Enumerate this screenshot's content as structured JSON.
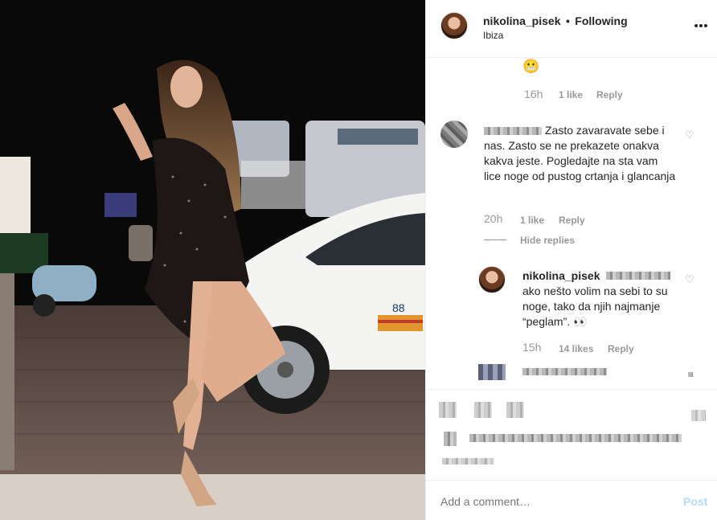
{
  "post": {
    "username": "nikolina_pisek",
    "separator": "•",
    "follow_status": "Following",
    "location": "Ibiza",
    "more_icon": "more-horizontal-icon"
  },
  "comments": [
    {
      "emoji": "😬",
      "time": "16h",
      "likes": "1 like",
      "reply": "Reply"
    },
    {
      "text": "Zasto zavaravate sebe i nas. Zasto se ne prekazete onakva kakva jeste. Pogledajte na sta vam lice noge od pustog crtanja i glancanja",
      "time": "20h",
      "likes": "1 like",
      "reply": "Reply",
      "hide_replies": "Hide replies"
    },
    {
      "username": "nikolina_pisek",
      "text": "ako nešto volim na sebi to su noge, tako da njih najmanje “peglam”. 👀",
      "time": "15h",
      "likes": "14 likes",
      "reply": "Reply"
    }
  ],
  "footer": {
    "placeholder": "Add a comment…",
    "post_label": "Post"
  },
  "colors": {
    "text": "#262626",
    "muted": "#999999",
    "post_disabled": "#b3dbff",
    "border": "#efefef"
  }
}
